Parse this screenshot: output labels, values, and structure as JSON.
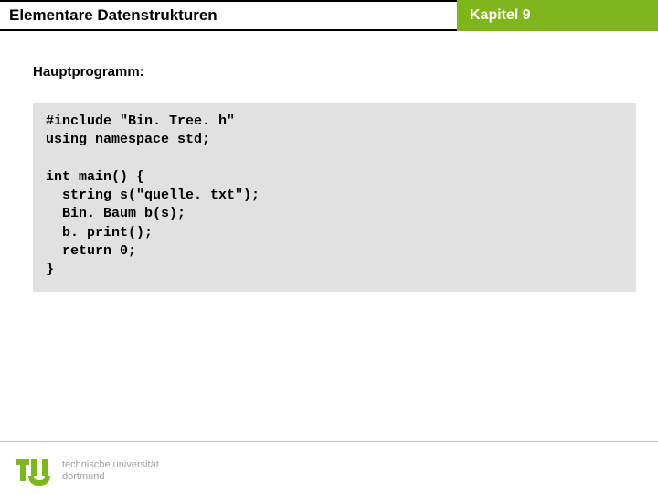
{
  "header": {
    "title": "Elementare Datenstrukturen",
    "chapter": "Kapitel 9"
  },
  "subheading": "Hauptprogramm:",
  "code_lines": [
    "#include \"Bin. Tree. h\"",
    "using namespace std;",
    "",
    "int main() {",
    "  string s(\"quelle. txt\");",
    "  Bin. Baum b(s);",
    "  b. print();",
    "  return 0;",
    "}"
  ],
  "footer": {
    "uni_line1": "technische universität",
    "uni_line2": "dortmund",
    "page": ""
  },
  "colors": {
    "accent": "#7fb61c"
  }
}
